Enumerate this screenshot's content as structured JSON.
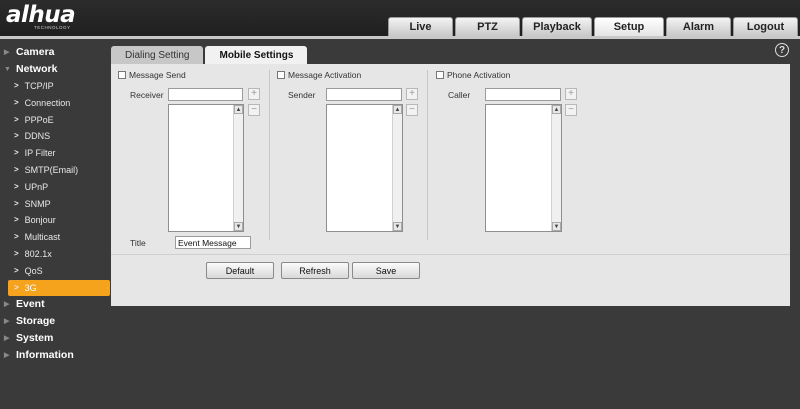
{
  "header": {
    "logo_text": "alhua",
    "logo_sub": "TECHNOLOGY",
    "tabs": [
      {
        "label": "Live"
      },
      {
        "label": "PTZ"
      },
      {
        "label": "Playback"
      },
      {
        "label": "Setup",
        "active": true
      },
      {
        "label": "Alarm"
      },
      {
        "label": "Logout"
      }
    ]
  },
  "sidebar": {
    "camera": "Camera",
    "network": "Network",
    "items": [
      "TCP/IP",
      "Connection",
      "PPPoE",
      "DDNS",
      "IP Filter",
      "SMTP(Email)",
      "UPnP",
      "SNMP",
      "Bonjour",
      "Multicast",
      "802.1x",
      "QoS",
      "3G"
    ],
    "active_item": "3G",
    "event": "Event",
    "storage": "Storage",
    "system": "System",
    "information": "Information"
  },
  "subtabs": [
    {
      "label": "Dialing Setting"
    },
    {
      "label": "Mobile Settings",
      "active": true
    }
  ],
  "help_icon": "?",
  "message_send": {
    "checkbox_label": "Message Send",
    "receiver_label": "Receiver",
    "receiver_value": "",
    "title_label": "Title",
    "title_value": "Event Message"
  },
  "message_activation": {
    "checkbox_label": "Message Activation",
    "sender_label": "Sender",
    "sender_value": ""
  },
  "phone_activation": {
    "checkbox_label": "Phone Activation",
    "caller_label": "Caller",
    "caller_value": ""
  },
  "icons": {
    "add": "+",
    "remove": "−",
    "scroll_up": "▲",
    "scroll_down": "▼"
  },
  "buttons": {
    "default": "Default",
    "refresh": "Refresh",
    "save": "Save"
  },
  "colors": {
    "accent": "#f5a21c",
    "background": "#3a3a3a",
    "panel": "#e6e6e6"
  }
}
